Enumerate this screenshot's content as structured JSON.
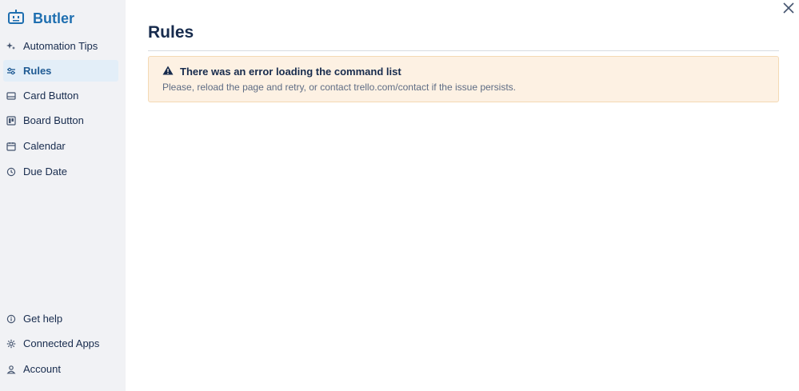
{
  "app": {
    "brand": "Butler",
    "brand_color": "#1f6fb0"
  },
  "sidebar": {
    "top_items": [
      {
        "label": "Automation Tips",
        "icon": "sparkle-icon",
        "active": false
      },
      {
        "label": "Rules",
        "icon": "sliders-icon",
        "active": true
      },
      {
        "label": "Card Button",
        "icon": "card-icon",
        "active": false
      },
      {
        "label": "Board Button",
        "icon": "board-icon",
        "active": false
      },
      {
        "label": "Calendar",
        "icon": "calendar-icon",
        "active": false
      },
      {
        "label": "Due Date",
        "icon": "clock-icon",
        "active": false
      }
    ],
    "bottom_items": [
      {
        "label": "Get help",
        "icon": "info-icon"
      },
      {
        "label": "Connected Apps",
        "icon": "gear-icon"
      },
      {
        "label": "Account",
        "icon": "user-icon"
      }
    ]
  },
  "main": {
    "title": "Rules",
    "error": {
      "title": "There was an error loading the command list",
      "message": "Please, reload the page and retry, or contact trello.com/contact if the issue persists.",
      "icon": "warning-icon"
    }
  }
}
